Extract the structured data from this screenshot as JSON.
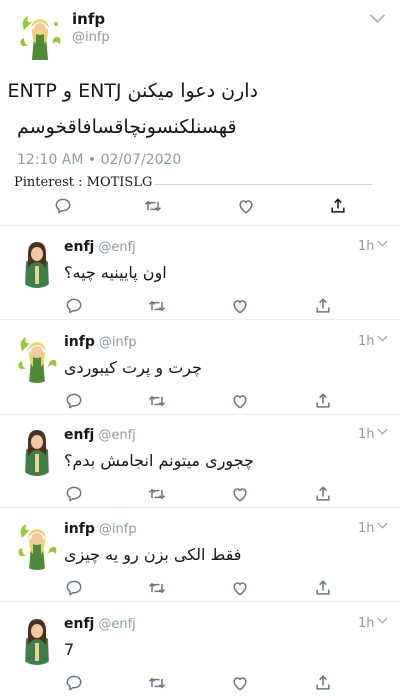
{
  "main_tweet": {
    "name": "infp",
    "handle": "@infp",
    "line1": "دارن دعوا میکنن ENTJ و ENTP",
    "line2": "قهسنلکنسونچاقسافاقخوسم",
    "time": "12:10 AM • 02/07/2020"
  },
  "watermark": "Pinterest : MOTISLG",
  "replies": [
    {
      "name": "enfj",
      "handle": "@enfj",
      "time": "1h",
      "text": "اون پایینیه چیه؟",
      "avatar": "enfj"
    },
    {
      "name": "infp",
      "handle": "@infp",
      "time": "1h",
      "text": "چرت و پرت کیبوردی",
      "avatar": "infp"
    },
    {
      "name": "enfj",
      "handle": "@enfj",
      "time": "1h",
      "text": "چجوری میتونم انجامش بدم؟",
      "avatar": "enfj"
    },
    {
      "name": "infp",
      "handle": "@infp",
      "time": "1h",
      "text": "فقط الکی بزن رو یه چیزی",
      "avatar": "infp"
    },
    {
      "name": "enfj",
      "handle": "@enfj",
      "time": "1h",
      "text": "7",
      "avatar": "enfj"
    }
  ],
  "icons": {
    "reply": "reply-icon",
    "retweet": "retweet-icon",
    "like": "heart-icon",
    "share": "share-icon",
    "menu": "chevron-down-icon"
  },
  "colors": {
    "icon_gray": "#657786",
    "handle_gray": "#8899a6",
    "divider": "#e6ecf0"
  }
}
